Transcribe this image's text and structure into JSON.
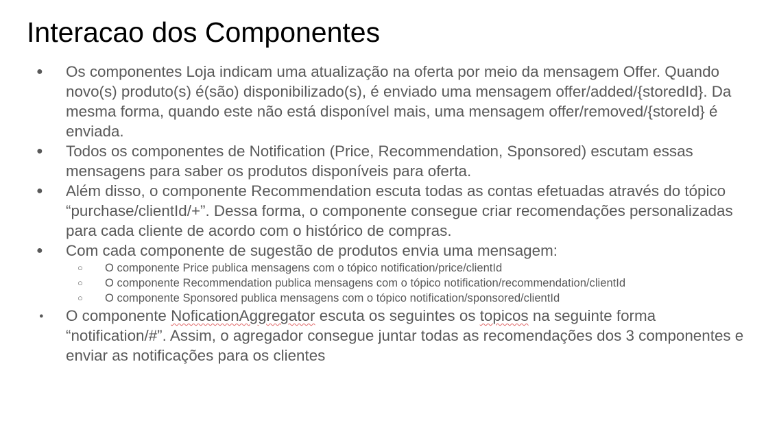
{
  "title": "Interacao dos Componentes",
  "bullets": [
    {
      "marker": "●",
      "text": "Os componentes Loja indicam uma atualização na oferta por meio da mensagem Offer. Quando novo(s) produto(s) é(são) disponibilizado(s), é enviado uma mensagem offer/added/{storedId}. Da mesma forma, quando este não está disponível mais, uma mensagem offer/removed/{storeId} é enviada."
    },
    {
      "marker": "●",
      "text": "Todos os componentes de Notification (Price, Recommendation, Sponsored) escutam essas mensagens para saber os produtos disponíveis para oferta."
    },
    {
      "marker": "●",
      "text": "Além disso, o componente Recommendation escuta todas as contas efetuadas através do tópico “purchase/clientId/+”. Dessa forma, o componente consegue criar recomendações personalizadas para cada cliente de acordo com o histórico de compras."
    },
    {
      "marker": "●",
      "text": "Com cada componente de sugestão de produtos envia uma mensagem:"
    }
  ],
  "subbullets": [
    {
      "marker": "○",
      "text": "O componente Price publica mensagens com o tópico notification/price/clientId"
    },
    {
      "marker": "○",
      "text": "O componente Recommendation publica mensagens com o tópico notification/recommendation/clientId"
    },
    {
      "marker": "○",
      "text": "O componente Sponsored publica mensagens com o tópico notification/sponsored/clientId"
    }
  ],
  "last_bullet": {
    "marker": "●",
    "part1": "O componente ",
    "word1": "NoficationAggregator",
    "part2": " escuta os seguintes os ",
    "word2": "topicos",
    "part3": " na seguinte forma “notification/#”. Assim, o agregador consegue juntar todas as recomendações dos 3 componentes e enviar as notificações para os clientes"
  }
}
